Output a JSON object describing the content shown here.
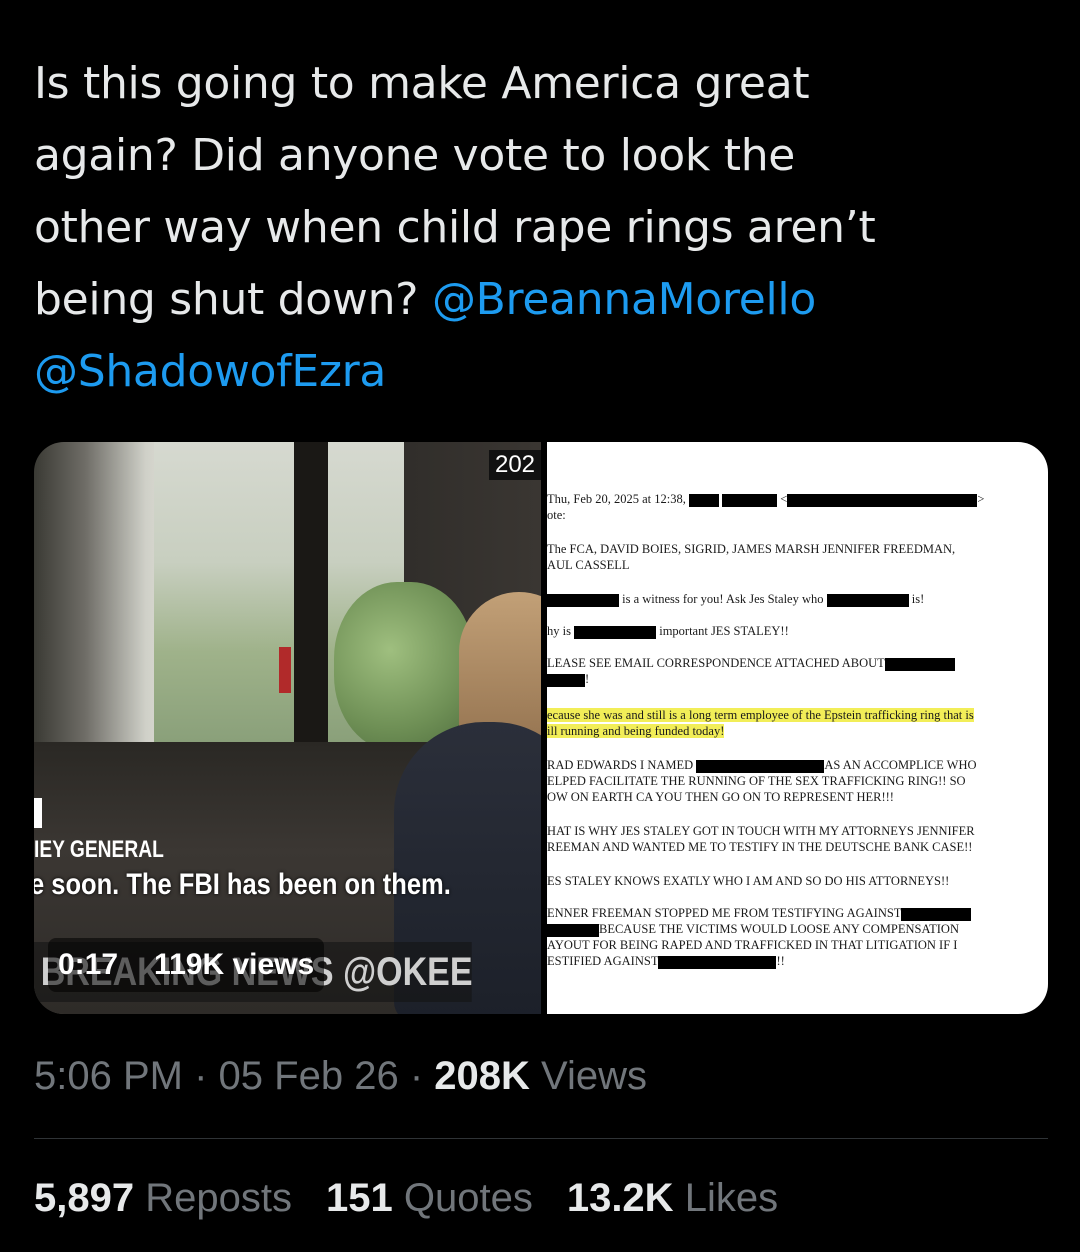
{
  "tweet": {
    "text_line1": "Is this going to make America great",
    "text_line2": "again? Did anyone vote to look the",
    "text_line3": "other way when child rape rings aren’t",
    "text_line4_prefix": "being shut down? ",
    "mention1": "@BreannaMorello",
    "mention2": "@ShadowofEzra"
  },
  "video": {
    "year_badge": "202",
    "lower_third_label": "IEY GENERAL",
    "caption": "e soon. The FBI has been on them.",
    "ticker": "BREAKING NEWS @OKEEFEMED",
    "duration": "0:17",
    "views": "119K views"
  },
  "document": {
    "l1": "Thu, Feb 20, 2025 at 12:38,",
    "l2": "ote:",
    "l3": "The FCA, DAVID BOIES, SIGRID, JAMES MARSH JENNIFER FREEDMAN,",
    "l4": "AUL CASSELL",
    "l5": "is a witness for you! Ask Jes Staley who",
    "l5b": "is!",
    "l6": "hy is",
    "l6b": "important JES STALEY!!",
    "l7": "LEASE SEE EMAIL CORRESPONDENCE ATTACHED ABOUT",
    "l7b": "!",
    "l8": "ecause she was and still is a long term employee of the Epstein trafficking ring that is",
    "l9": "ill running and being funded today!",
    "l10": "RAD EDWARDS I NAMED",
    "l10b": "AS AN ACCOMPLICE WHO",
    "l11": "ELPED FACILITATE THE RUNNING OF THE SEX TRAFFICKING RING!!  SO",
    "l12": "OW ON EARTH CA  YOU THEN GO ON TO REPRESENT HER!!!",
    "l13": "HAT IS WHY JES STALEY GOT IN TOUCH WITH MY ATTORNEYS JENNIFER",
    "l14": "REEMAN AND WANTED ME TO TESTIFY IN THE DEUTSCHE BANK CASE!!",
    "l15": "ES STALEY KNOWS EXATLY WHO I AM AND SO DO HIS ATTORNEYS!!",
    "l16": "ENNER FREEMAN STOPPED ME FROM TESTIFYING AGAINST",
    "l17": "BECAUSE THE VICTIMS WOULD LOOSE ANY COMPENSATION",
    "l18": "AYOUT FOR BEING RAPED AND TRAFFICKED IN THAT LITIGATION IF I",
    "l19": "ESTIFIED AGAINST",
    "l19b": "!!"
  },
  "meta": {
    "time": "5:06 PM",
    "date": "05 Feb 26",
    "views_count": "208K",
    "views_label": "Views",
    "separator": "·"
  },
  "stats": {
    "reposts_count": "5,897",
    "reposts_label": "Reposts",
    "quotes_count": "151",
    "quotes_label": "Quotes",
    "likes_count": "13.2K",
    "likes_label": "Likes"
  },
  "colors": {
    "background": "#000000",
    "text": "#e7e9ea",
    "muted": "#71767b",
    "mention": "#1d9bf0",
    "highlight": "#f2ee58"
  }
}
